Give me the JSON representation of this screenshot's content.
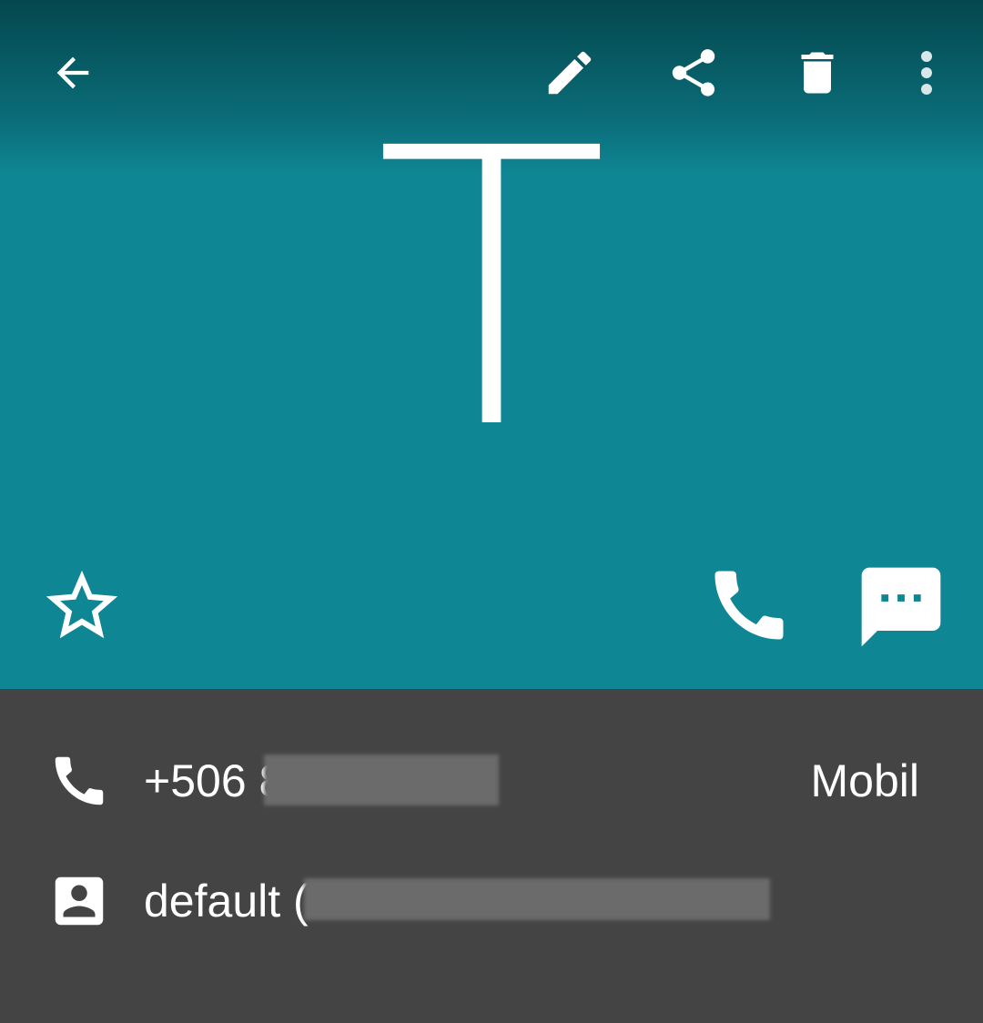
{
  "toolbar": {
    "back_icon": "arrow-back-icon",
    "edit_icon": "pencil-icon",
    "share_icon": "share-icon",
    "delete_icon": "trash-icon",
    "more_icon": "more-vert-icon"
  },
  "contact": {
    "avatar_letter": "T",
    "favorite_icon": "star-outline-icon",
    "call_icon": "phone-icon",
    "message_icon": "message-icon"
  },
  "details": {
    "phone": {
      "icon": "phone-icon",
      "value": "+506 8",
      "type": "Mobil"
    },
    "account": {
      "icon": "account-box-icon",
      "value": "default ("
    }
  },
  "colors": {
    "header": "#0f8694",
    "header_top": "#04474e",
    "details_bg": "#444444",
    "text": "#ffffff",
    "redaction": "#6b6b6b"
  }
}
